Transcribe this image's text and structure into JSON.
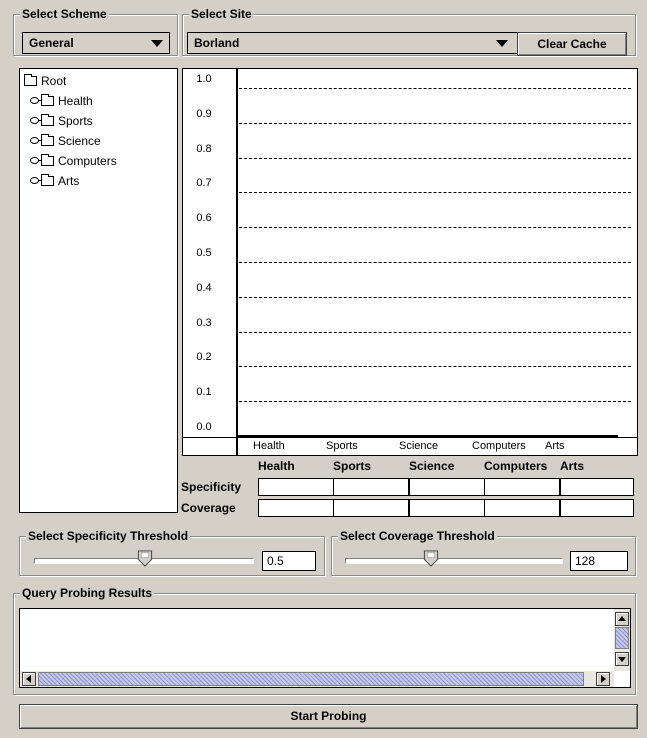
{
  "scheme": {
    "title": "Select Scheme",
    "value": "General"
  },
  "site": {
    "title": "Select Site",
    "value": "Borland",
    "clear_label": "Clear Cache"
  },
  "tree": {
    "root": "Root",
    "children": [
      "Health",
      "Sports",
      "Science",
      "Computers",
      "Arts"
    ]
  },
  "chart_data": {
    "type": "bar",
    "categories": [
      "Health",
      "Sports",
      "Science",
      "Computers",
      "Arts"
    ],
    "values": [
      0,
      0,
      0,
      0,
      0
    ],
    "ylim": [
      0.0,
      1.0
    ],
    "yticks": [
      "1.0",
      "0.9",
      "0.8",
      "0.7",
      "0.6",
      "0.5",
      "0.4",
      "0.3",
      "0.2",
      "0.1",
      "0.0"
    ],
    "grid": true
  },
  "table": {
    "columns": [
      "Health",
      "Sports",
      "Science",
      "Computers",
      "Arts"
    ],
    "rows": [
      "Specificity",
      "Coverage"
    ]
  },
  "specificity_threshold": {
    "title": "Select Specificity Threshold",
    "value": "0.5"
  },
  "coverage_threshold": {
    "title": "Select Coverage Threshold",
    "value": "128"
  },
  "results": {
    "title": "Query Probing Results"
  },
  "start_label": "Start Probing"
}
